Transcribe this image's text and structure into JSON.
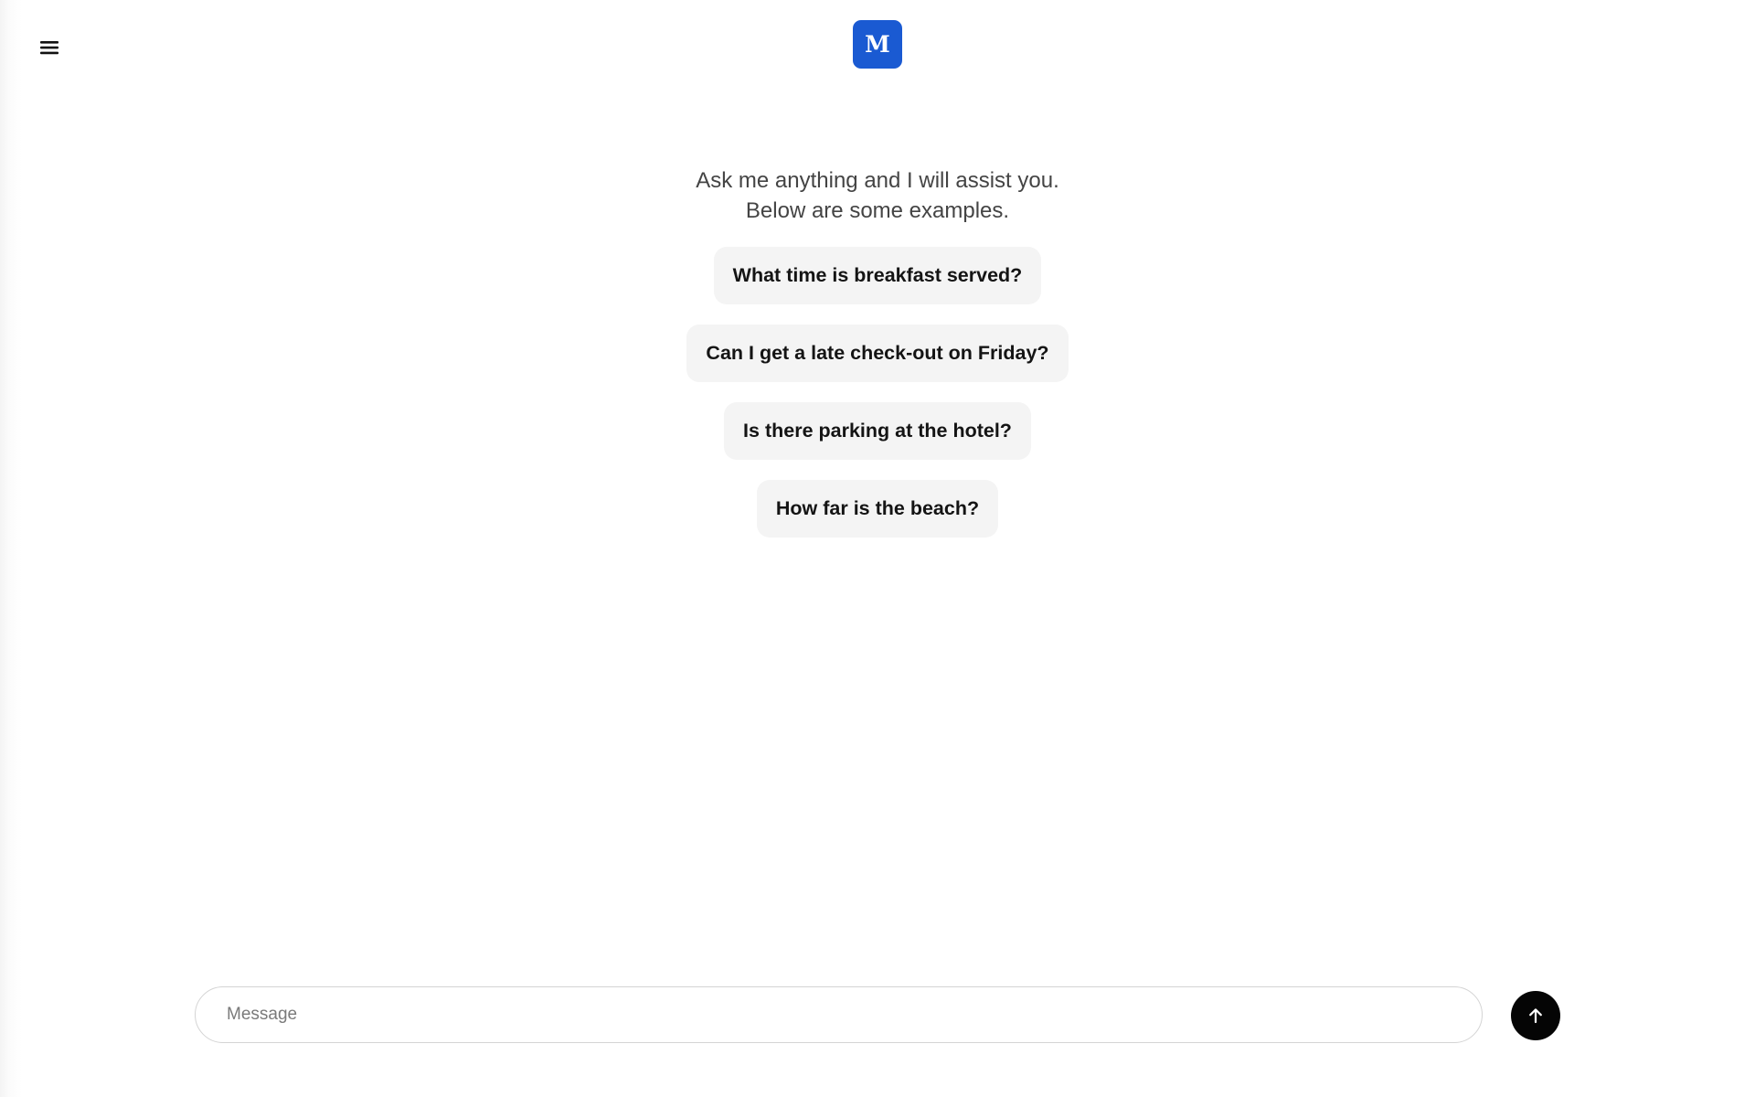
{
  "header": {
    "menu_icon": "hamburger-menu-icon",
    "logo_letter": "M",
    "logo_color": "#1a5ad2"
  },
  "intro": {
    "line1": "Ask me anything and I will assist you.",
    "line2": "Below are some examples."
  },
  "suggestions": [
    {
      "label": "What time is breakfast served?"
    },
    {
      "label": "Can I get a late check-out on Friday?"
    },
    {
      "label": "Is there parking at the hotel?"
    },
    {
      "label": "How far is the beach?"
    }
  ],
  "composer": {
    "placeholder": "Message",
    "value": "",
    "send_icon": "arrow-up-icon"
  }
}
